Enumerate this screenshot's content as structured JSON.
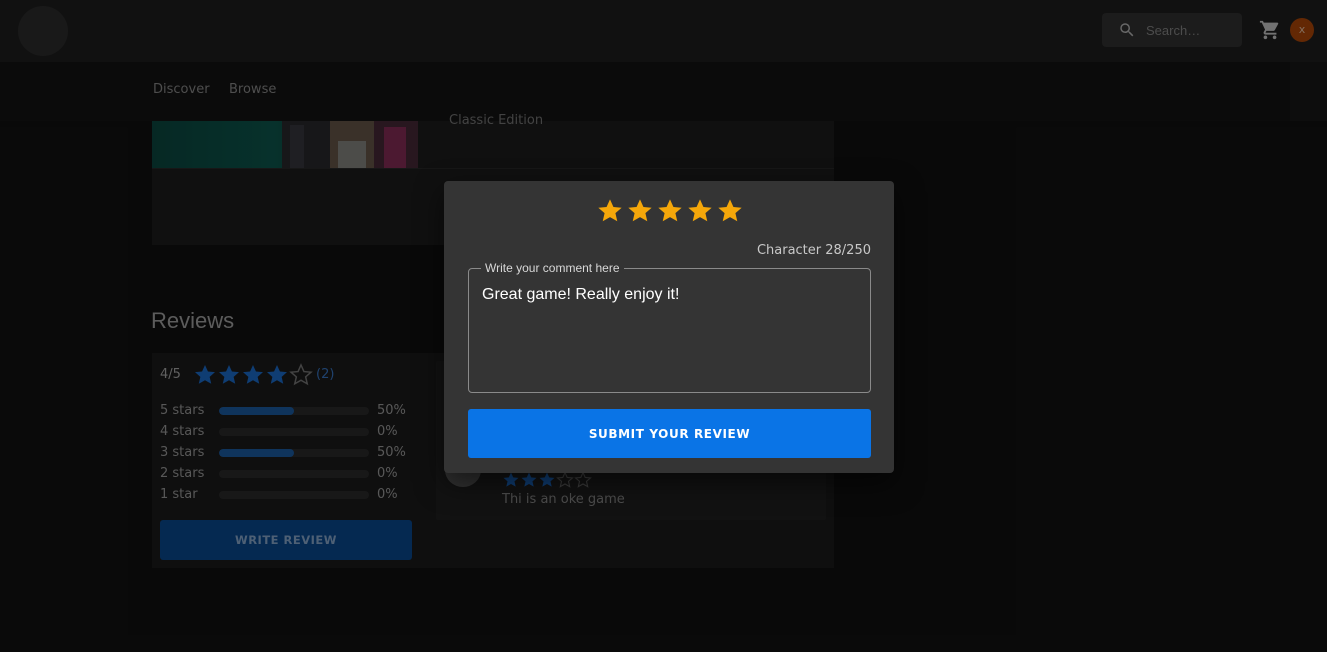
{
  "topbar": {
    "search_placeholder": "Search…",
    "avatar_initial": "x"
  },
  "nav": {
    "items": [
      {
        "label": "Discover"
      },
      {
        "label": "Browse"
      }
    ]
  },
  "game": {
    "edition": "Classic Edition"
  },
  "reviews": {
    "title": "Reviews",
    "average_label": "4/5",
    "average": 4,
    "count_label": "(2)",
    "distribution": [
      {
        "label": "5 stars",
        "percent": 50,
        "percent_label": "50%"
      },
      {
        "label": "4 stars",
        "percent": 0,
        "percent_label": "0%"
      },
      {
        "label": "3 stars",
        "percent": 50,
        "percent_label": "50%"
      },
      {
        "label": "2 stars",
        "percent": 0,
        "percent_label": "0%"
      },
      {
        "label": "1 star",
        "percent": 0,
        "percent_label": "0%"
      }
    ],
    "write_button": "WRITE REVIEW",
    "items": [
      {
        "rating": 3,
        "text": "Thi is an oke game"
      }
    ]
  },
  "modal": {
    "rating": 5,
    "char_count": "Character 28/250",
    "field_label": "Write your comment here",
    "comment_value": "Great game! Really enjoy it!",
    "submit_label": "SUBMIT YOUR REVIEW"
  },
  "colors": {
    "accent_blue": "#0a74e6",
    "star_gold": "#f5a70a",
    "star_blue": "#1c6fd1",
    "avatar_orange": "#b54a09"
  }
}
